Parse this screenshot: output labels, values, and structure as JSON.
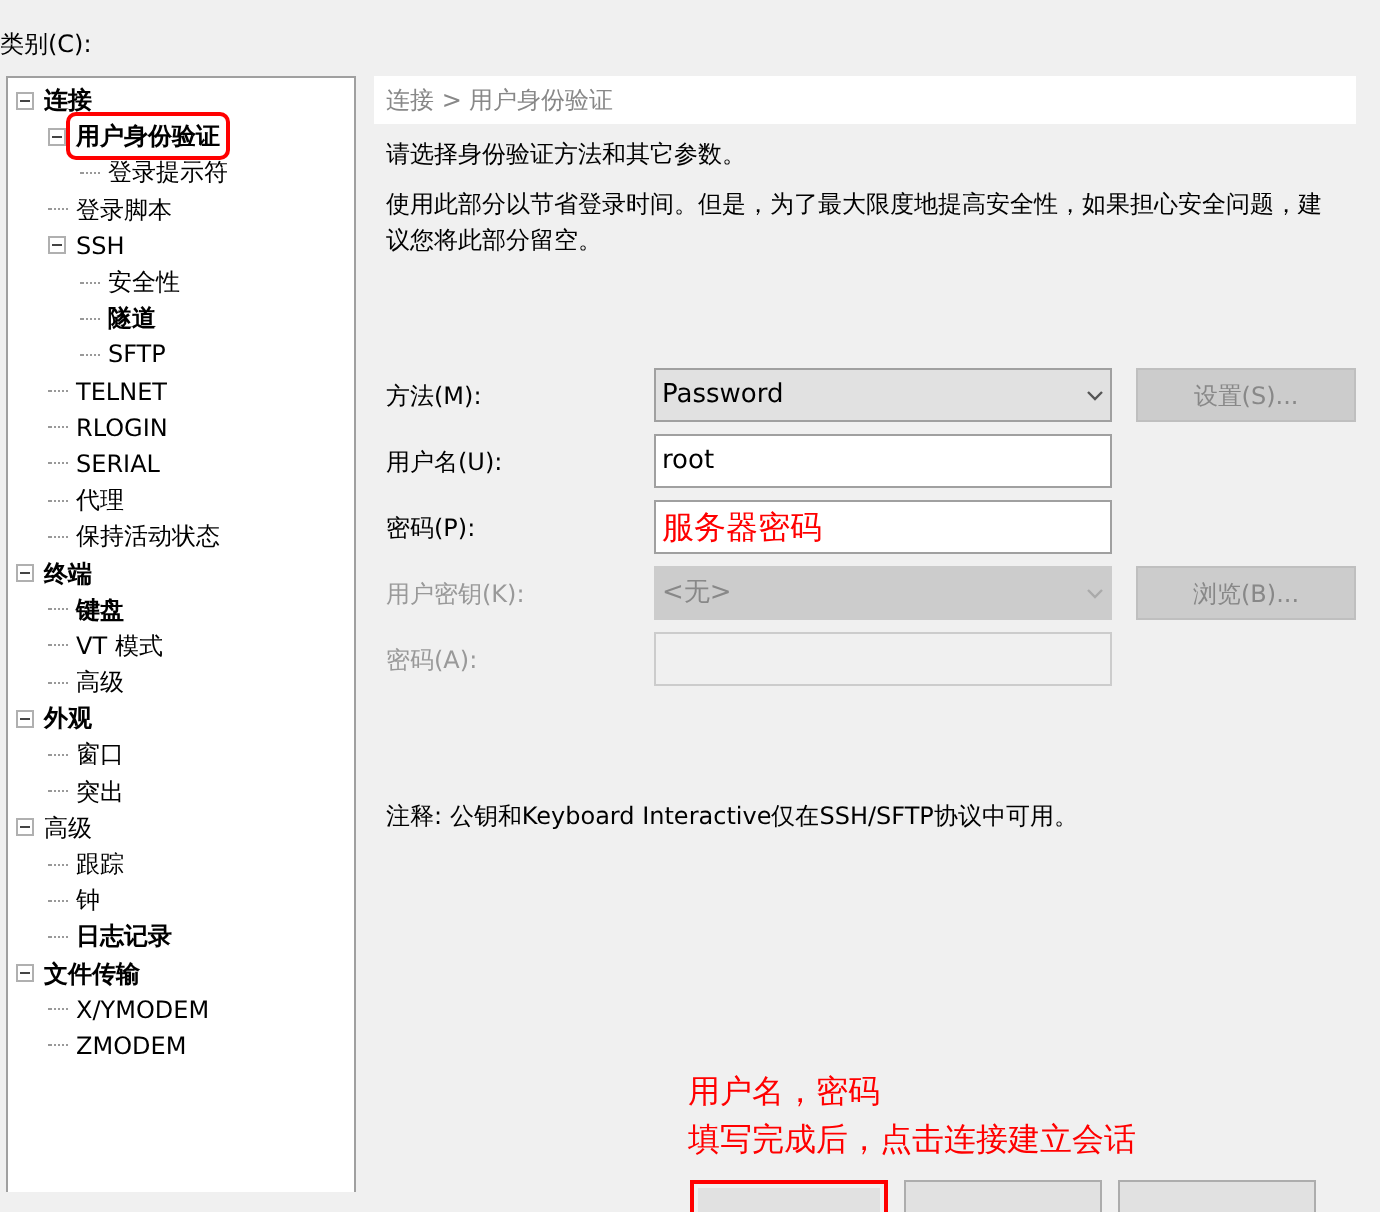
{
  "category_label": "类别(C):",
  "tree": [
    {
      "label": "连接",
      "bold": true,
      "highlighted": false,
      "expanded": true,
      "children": [
        {
          "label": "用户身份验证",
          "bold": true,
          "highlighted": true,
          "expanded": true,
          "children": [
            {
              "label": "登录提示符",
              "bold": false,
              "highlighted": false
            }
          ]
        },
        {
          "label": "登录脚本",
          "bold": false,
          "highlighted": false
        },
        {
          "label": "SSH",
          "bold": false,
          "highlighted": false,
          "expanded": true,
          "children": [
            {
              "label": "安全性",
              "bold": false,
              "highlighted": false
            },
            {
              "label": "隧道",
              "bold": true,
              "highlighted": false
            },
            {
              "label": "SFTP",
              "bold": false,
              "highlighted": false
            }
          ]
        },
        {
          "label": "TELNET",
          "bold": false,
          "highlighted": false
        },
        {
          "label": "RLOGIN",
          "bold": false,
          "highlighted": false
        },
        {
          "label": "SERIAL",
          "bold": false,
          "highlighted": false
        },
        {
          "label": "代理",
          "bold": false,
          "highlighted": false
        },
        {
          "label": "保持活动状态",
          "bold": false,
          "highlighted": false
        }
      ]
    },
    {
      "label": "终端",
      "bold": true,
      "highlighted": false,
      "expanded": true,
      "children": [
        {
          "label": "键盘",
          "bold": true,
          "highlighted": false
        },
        {
          "label": "VT 模式",
          "bold": false,
          "highlighted": false
        },
        {
          "label": "高级",
          "bold": false,
          "highlighted": false
        }
      ]
    },
    {
      "label": "外观",
      "bold": true,
      "highlighted": false,
      "expanded": true,
      "children": [
        {
          "label": "窗口",
          "bold": false,
          "highlighted": false
        },
        {
          "label": "突出",
          "bold": false,
          "highlighted": false
        }
      ]
    },
    {
      "label": "高级",
      "bold": false,
      "highlighted": false,
      "expanded": true,
      "children": [
        {
          "label": "跟踪",
          "bold": false,
          "highlighted": false
        },
        {
          "label": "钟",
          "bold": false,
          "highlighted": false
        },
        {
          "label": "日志记录",
          "bold": true,
          "highlighted": false
        }
      ]
    },
    {
      "label": "文件传输",
      "bold": true,
      "highlighted": false,
      "expanded": true,
      "children": [
        {
          "label": "X/YMODEM",
          "bold": false,
          "highlighted": false
        },
        {
          "label": "ZMODEM",
          "bold": false,
          "highlighted": false
        }
      ]
    }
  ],
  "panel": {
    "breadcrumb": "连接 > 用户身份验证",
    "intro": "请选择身份验证方法和其它参数。",
    "description": "使用此部分以节省登录时间。但是，为了最大限度地提高安全性，如果担心安全问题，建议您将此部分留空。",
    "fields": [
      {
        "label": "方法(M):",
        "kind": "select",
        "value": "Password",
        "disabled": false,
        "annotated": false,
        "button": {
          "label": "设置(S)...",
          "disabled": true
        }
      },
      {
        "label": "用户名(U):",
        "kind": "text",
        "value": "root",
        "disabled": false,
        "annotated": false
      },
      {
        "label": "密码(P):",
        "kind": "text",
        "value": "服务器密码",
        "disabled": false,
        "annotated": true
      },
      {
        "label": "用户密钥(K):",
        "kind": "select",
        "value": "<无>",
        "disabled": true,
        "annotated": false,
        "button": {
          "label": "浏览(B)...",
          "disabled": true
        }
      },
      {
        "label": "密码(A):",
        "kind": "text",
        "disabled": true,
        "annotated": false
      }
    ],
    "note": "注释: 公钥和Keyboard Interactive仅在SSH/SFTP协议中可用。"
  },
  "annotation": [
    "用户名，密码",
    "填写完成后，点击连接建立会话"
  ],
  "bottom_buttons": [
    {
      "highlighted": true
    },
    {
      "highlighted": false
    },
    {
      "highlighted": false
    }
  ]
}
